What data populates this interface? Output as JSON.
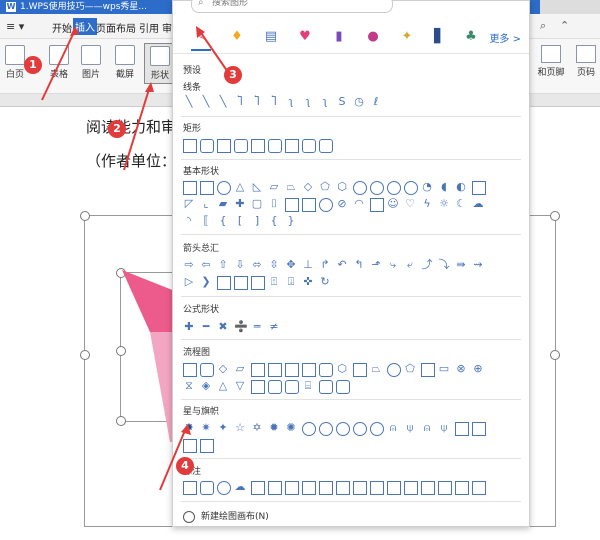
{
  "titlebar": {
    "app_icon": "W",
    "title": "1.WPS使用技巧——wps秀星..."
  },
  "menubar": {
    "items": [
      "开始",
      "插入",
      "页面布局",
      "引用",
      "审阅"
    ]
  },
  "toolbar": {
    "pages": "白页",
    "table": "表格",
    "picture": "图片",
    "screenshot": "截屏",
    "shape": "形状",
    "header_footer": "和页脚",
    "page_number": "页码"
  },
  "document": {
    "line1": "阅读能力和审",
    "line2": "（作者单位："
  },
  "panel": {
    "search_placeholder": "搜索图形",
    "more": "更多 >",
    "sections": {
      "preset": "预设",
      "lines": "线条",
      "rect": "矩形",
      "basic": "基本形状",
      "arrows": "箭头总汇",
      "formula": "公式形状",
      "flowchart": "流程图",
      "stars": "星与旗帜",
      "callouts": "标注"
    },
    "new_canvas": "新建绘图画布(N)"
  },
  "annotations": {
    "b1": "1",
    "b2": "2",
    "b3": "3",
    "b4": "4"
  },
  "colors": {
    "accent": "#2d6cc8",
    "annotation": "#e23b3b",
    "shape_outline": "#4a76b8"
  }
}
